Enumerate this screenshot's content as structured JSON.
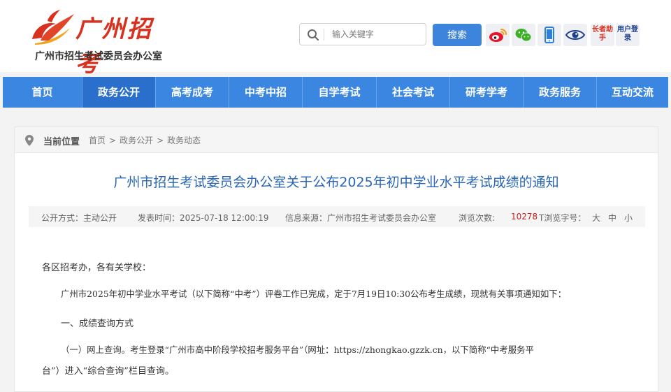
{
  "header": {
    "logo_text": "广州招考",
    "site_name": "广州市招生考试委员会办公室",
    "search_placeholder": "输入关键字",
    "search_button": "搜索",
    "quick_links": [
      {
        "name": "weibo",
        "icon": "weibo-icon"
      },
      {
        "name": "wechat",
        "icon": "wechat-icon"
      },
      {
        "name": "mobile",
        "icon": "mobile-icon"
      },
      {
        "name": "accessibility",
        "icon": "eye-icon"
      },
      {
        "name": "elder",
        "label": "长者助手"
      },
      {
        "name": "login",
        "label": "用户登录"
      }
    ]
  },
  "nav": {
    "items": [
      "首页",
      "政务公开",
      "高考成考",
      "中考中招",
      "自学考试",
      "社会考试",
      "研考学考",
      "政务服务",
      "互动交流"
    ],
    "active": "政务公开"
  },
  "breadcrumb": {
    "label": "当前位置",
    "items": [
      "首页",
      "政务公开",
      "政务动态"
    ]
  },
  "article": {
    "title": "广州市招生考试委员会办公室关于公布2025年初中学业水平考试成绩的通知",
    "meta": {
      "open_way": "公开方式：主动公开",
      "publish_time": "发表时间：2025-07-18 12:00:19",
      "source": "信息来源：广州市招生考试委员会办公室",
      "views_label": "浏览次数:",
      "views": "10278",
      "font_size_label": "T浏览字号：",
      "sizes": [
        "大",
        "中",
        "小"
      ]
    },
    "paragraphs": [
      "各区招考办，各有关学校：",
      "广州市2025年初中学业水平考试（以下简称“中考”）评卷工作已完成，定于7月19日10:30公布考生成绩，现就有关事项通知如下：",
      "一、成绩查询方式",
      "（一）网上查询。考生登录“广州市高中阶段学校招考服务平台”（网址：https://zhongkao.gzzk.cn，以下简称“中考服务平",
      "台”）进入“综合查询”栏目查询。"
    ]
  },
  "colors": {
    "nav_bg": "#3a86e0",
    "nav_active": "#2a6fcc",
    "title": "#2a66b8",
    "logo_red": "#d8311f",
    "views": "#c81e1e"
  }
}
